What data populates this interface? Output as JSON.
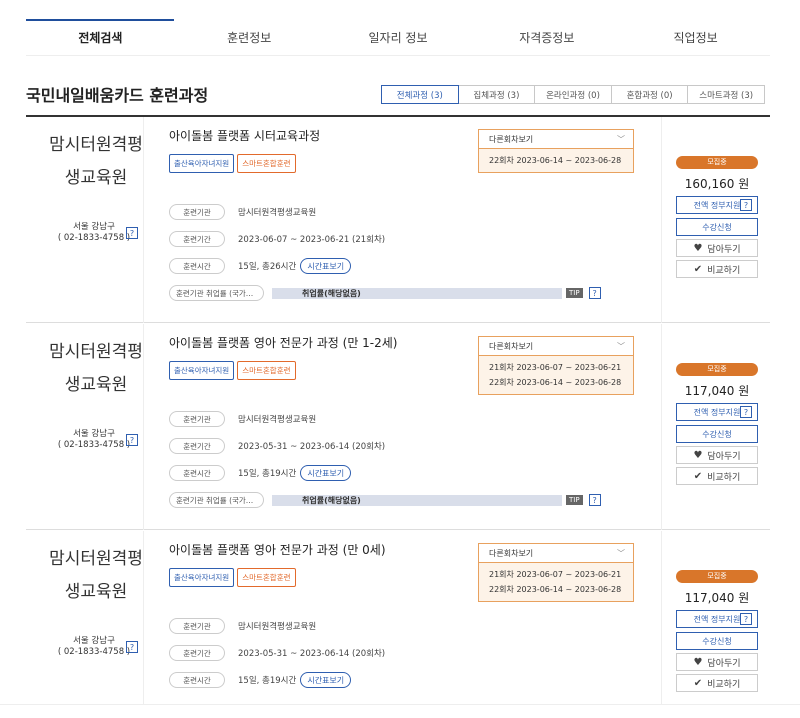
{
  "nav": {
    "tabs": [
      "전체검색",
      "훈련정보",
      "일자리 정보",
      "자격증정보",
      "직업정보"
    ]
  },
  "section": {
    "title": "국민내일배움카드 훈련과정",
    "filters": [
      "전체과정 (3)",
      "집체과정 (3)",
      "온라인과정 (0)",
      "혼합과정 (0)",
      "스마트과정 (3)"
    ]
  },
  "labels": {
    "institution": "훈련기관",
    "period": "훈련기간",
    "time": "훈련시간",
    "timetable": "시간표보기",
    "employment": "훈련기관 취업률 (국가…",
    "employment_value": "취업률(해당없음)",
    "tip": "TIP",
    "question": "?",
    "session_select": "다른회차보기",
    "full_support": "전액 정부지원",
    "apply": "수강신청",
    "wishlist": "담아두기",
    "compare": "비교하기",
    "status": "모집중",
    "badge_blue": "출산육아자녀지원",
    "badge_orange": "스마트혼합훈련"
  },
  "courses": [
    {
      "institution": "맘시터원격평생교육원",
      "location": "서울 강남구",
      "phone": "( 02-1833-4758 )",
      "title": "아이돌봄 플랫폼 시터교육과정",
      "inst_value": "맘시터원격평생교육원",
      "period_value": "2023-06-07 ~ 2023-06-21 (21회차)",
      "time_value": "15일, 총26시간",
      "sessions": [
        "22회차 2023-06-14 ~ 2023-06-28"
      ],
      "price": "160,160 원"
    },
    {
      "institution": "맘시터원격평생교육원",
      "location": "서울 강남구",
      "phone": "( 02-1833-4758 )",
      "title": "아이돌봄 플랫폼 영아 전문가 과정 (만 1-2세)",
      "inst_value": "맘시터원격평생교육원",
      "period_value": "2023-05-31 ~ 2023-06-14 (20회차)",
      "time_value": "15일, 총19시간",
      "sessions": [
        "21회차 2023-06-07 ~ 2023-06-21",
        "22회차 2023-06-14 ~ 2023-06-28"
      ],
      "price": "117,040 원"
    },
    {
      "institution": "맘시터원격평생교육원",
      "location": "서울 강남구",
      "phone": "( 02-1833-4758 )",
      "title": "아이돌봄 플랫폼 영아 전문가 과정 (만 0세)",
      "inst_value": "맘시터원격평생교육원",
      "period_value": "2023-05-31 ~ 2023-06-14 (20회차)",
      "time_value": "15일, 총19시간",
      "sessions": [
        "21회차 2023-06-07 ~ 2023-06-21",
        "22회차 2023-06-14 ~ 2023-06-28"
      ],
      "price": "117,040 원"
    }
  ]
}
